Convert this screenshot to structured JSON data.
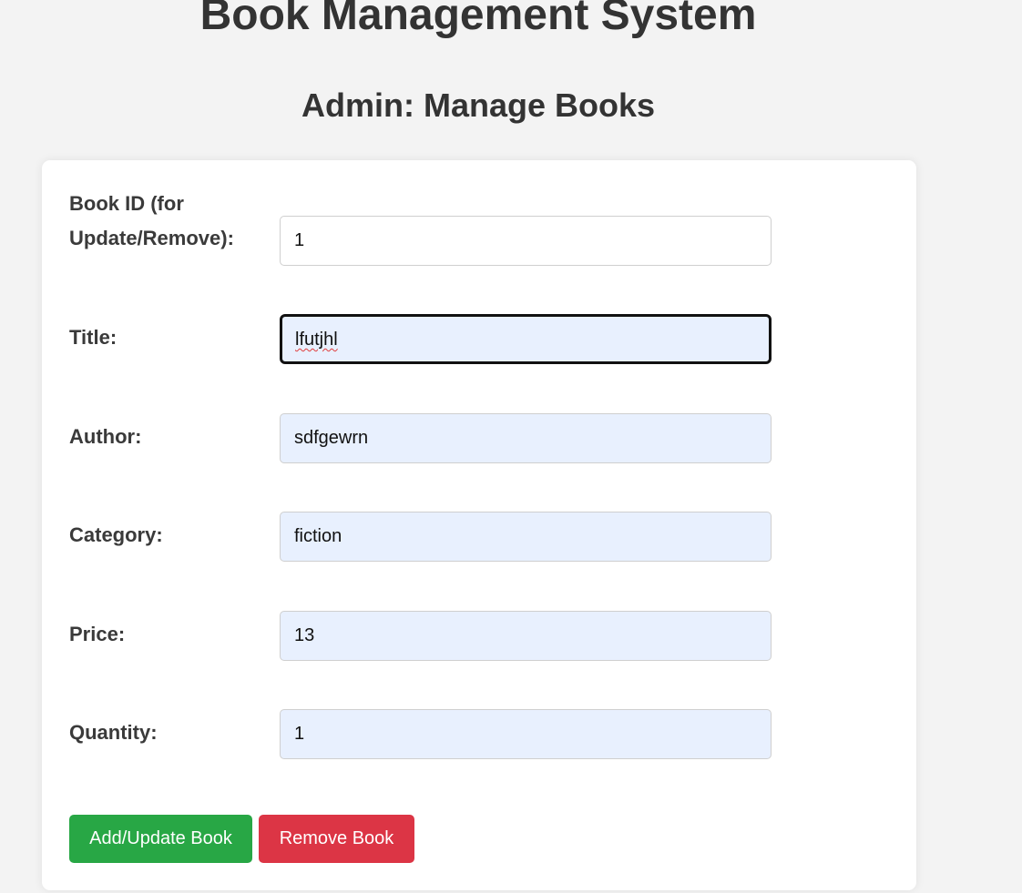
{
  "header": {
    "title": "Book Management System",
    "subtitle": "Admin: Manage Books"
  },
  "form": {
    "book_id": {
      "label_line1": "Book ID (for",
      "label_line2": "Update/Remove):",
      "value": "1"
    },
    "title": {
      "label": "Title:",
      "value": "lfutjhl"
    },
    "author": {
      "label": "Author:",
      "value": "sdfgewrn"
    },
    "category": {
      "label": "Category:",
      "value": "fiction"
    },
    "price": {
      "label": "Price:",
      "value": "13"
    },
    "quantity": {
      "label": "Quantity:",
      "value": "1"
    }
  },
  "actions": {
    "add_update_label": "Add/Update Book",
    "remove_label": "Remove Book"
  },
  "colors": {
    "page_background": "#f3f3f3",
    "card_background": "#ffffff",
    "autofill_background": "#e8f0fe",
    "add_button": "#28a745",
    "remove_button": "#dc3545",
    "text": "#333333"
  }
}
